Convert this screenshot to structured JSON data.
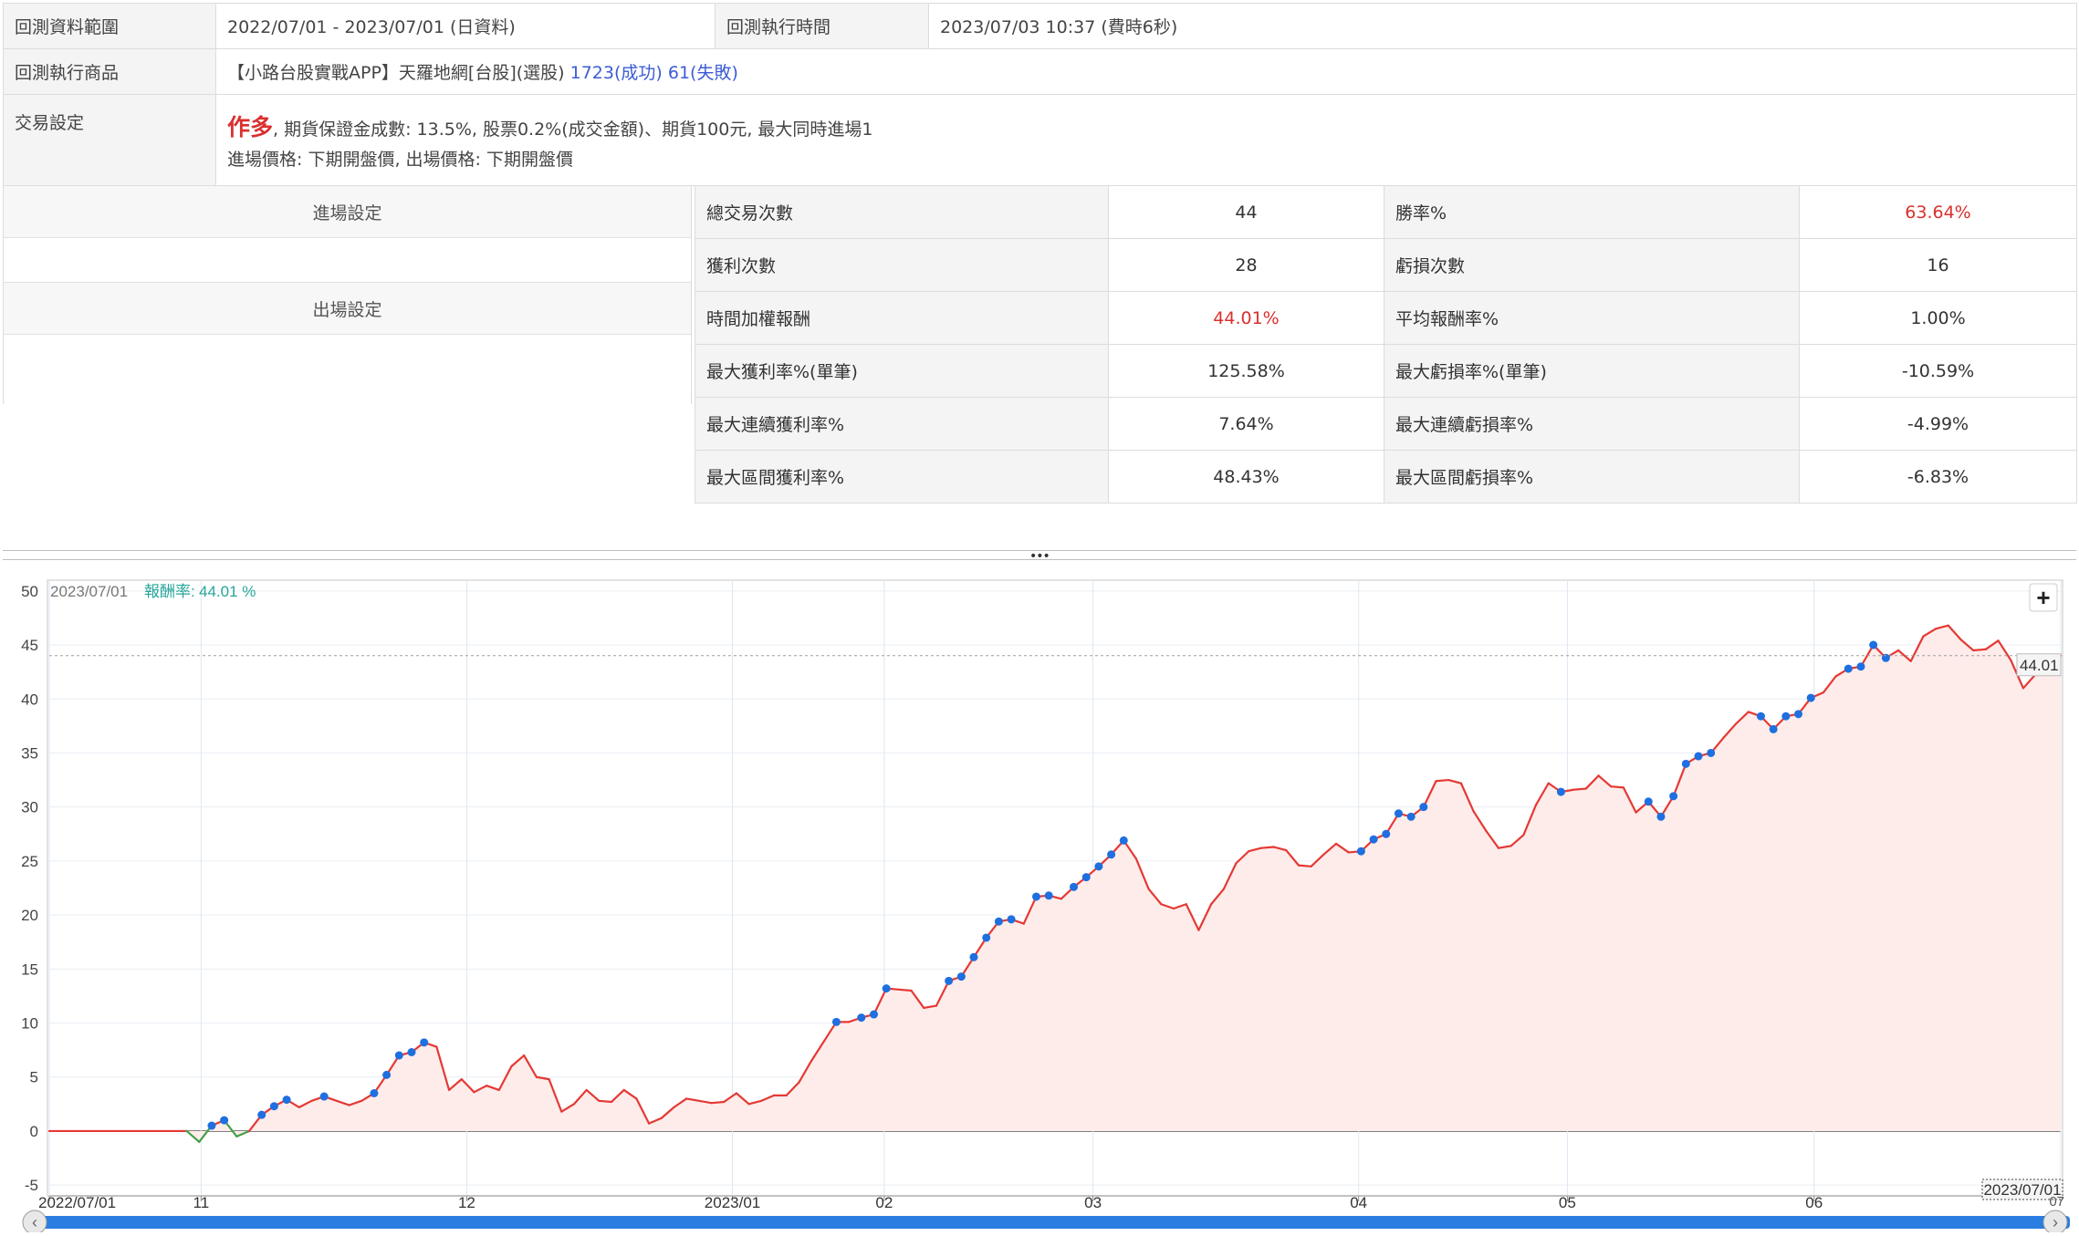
{
  "info": {
    "range_label": "回測資料範圍",
    "range_value": "2022/07/01 - 2023/07/01 (日資料)",
    "exec_time_label": "回測執行時間",
    "exec_time_value": "2023/07/03 10:37 (費時6秒)",
    "product_label": "回測執行商品",
    "product_value": "【小路台股實戰APP】天羅地網[台股](選股)",
    "product_success": "1723(成功)",
    "product_fail": "61(失敗)",
    "trade_label": "交易設定",
    "trade_direction": "作多",
    "trade_detail": ", 期貨保證金成數: 13.5%, 股票0.2%(成交金額)、期貨100元, 最大同時進場1",
    "trade_price": "進場價格: 下期開盤價, 出場價格: 下期開盤價"
  },
  "settings": {
    "entry_label": "進場設定",
    "exit_label": "出場設定"
  },
  "stats": [
    {
      "l1": "總交易次數",
      "v1": "44",
      "l2": "勝率%",
      "v2": "63.64%"
    },
    {
      "l1": "獲利次數",
      "v1": "28",
      "l2": "虧損次數",
      "v2": "16"
    },
    {
      "l1": "時間加權報酬",
      "v1": "44.01%",
      "l2": "平均報酬率%",
      "v2": "1.00%"
    },
    {
      "l1": "最大獲利率%(單筆)",
      "v1": "125.58%",
      "l2": "最大虧損率%(單筆)",
      "v2": "-10.59%"
    },
    {
      "l1": "最大連續獲利率%",
      "v1": "7.64%",
      "l2": "最大連續虧損率%",
      "v2": "-4.99%"
    },
    {
      "l1": "最大區間獲利率%",
      "v1": "48.43%",
      "l2": "最大區間虧損率%",
      "v2": "-6.83%"
    }
  ],
  "colors": {
    "positive_red": "#d9302e",
    "link_blue": "#3b5cd6",
    "line_red": "#e53935",
    "line_green": "#43a047",
    "marker_blue": "#1e6fe0",
    "area_fill": "#fdecea",
    "teal": "#26a69a",
    "scrollbar": "#2a7de1"
  },
  "chart_data": {
    "type": "area",
    "tooltip_date": "2023/07/01",
    "tooltip_label": "報酬率:",
    "tooltip_value": "44.01 %",
    "last_value_label": "44.01",
    "ylim": [
      -6,
      51
    ],
    "yticks": [
      -5,
      0,
      5,
      10,
      15,
      20,
      25,
      30,
      35,
      40,
      45,
      50
    ],
    "xticks": [
      {
        "label": "2022/07/01",
        "idx": 0
      },
      {
        "label": "11",
        "idx": 8
      },
      {
        "label": "12",
        "idx": 22
      },
      {
        "label": "2023/01",
        "idx": 36
      },
      {
        "label": "02",
        "idx": 44
      },
      {
        "label": "03",
        "idx": 55
      },
      {
        "label": "04",
        "idx": 69
      },
      {
        "label": "05",
        "idx": 80
      },
      {
        "label": "06",
        "idx": 93
      },
      {
        "label": "2023/07/01",
        "idx": 106
      }
    ],
    "navigator_end_label": "07",
    "plus_label": "+",
    "x_count": 107,
    "series": [
      {
        "values": [
          0,
          0,
          0,
          0,
          0,
          0,
          0,
          0,
          0,
          0,
          0,
          0,
          -1,
          0.5,
          1,
          -0.5,
          0,
          1.5,
          2.3,
          2.9,
          2.2,
          2.8,
          3.2,
          2.8,
          2.4,
          2.8,
          3.5,
          5.2,
          7,
          7.3,
          8.2,
          7.8,
          3.8,
          4.8,
          3.6,
          4.2,
          3.8,
          6,
          7,
          5,
          4.8,
          1.8,
          2.5,
          3.8,
          2.8,
          2.7,
          3.8,
          3,
          0.7,
          1.2,
          2.2,
          3,
          2.8,
          2.6,
          2.7,
          3.5,
          2.5,
          2.8,
          3.3,
          3.3,
          4.5,
          6.5,
          8.3,
          10.1,
          10.1,
          10.5,
          10.8,
          13.2,
          13.1,
          13,
          11.4,
          11.6,
          13.9,
          14.3,
          16.1,
          17.9,
          19.4,
          19.6,
          19.2,
          21.7,
          21.8,
          21.5,
          22.6,
          23.5,
          24.5,
          25.6,
          26.9,
          25.2,
          22.4,
          21,
          20.6,
          21,
          18.6,
          21,
          22.4,
          24.8,
          25.9,
          26.2,
          26.3,
          26,
          24.6,
          24.5,
          25.6,
          26.6,
          25.8,
          25.9,
          27,
          27.5,
          29.4,
          29.1,
          30,
          32.4,
          32.5,
          32.2,
          29.6,
          27.8,
          26.2,
          26.4,
          27.4,
          30.2,
          32.2,
          31.4,
          31.6,
          31.7,
          32.9,
          31.9,
          31.8,
          29.5,
          30.5,
          29.1,
          31,
          34,
          34.7,
          35,
          36.4,
          37.7,
          38.8,
          38.4,
          37.2,
          38.4,
          38.6,
          40.1,
          40.6,
          42.1,
          42.8,
          43,
          45,
          43.8,
          44.5,
          43.5,
          45.8,
          46.5,
          46.8,
          45.5,
          44.5,
          44.6,
          45.4,
          43.6,
          41,
          42.3,
          44,
          44.01
        ],
        "marker_indices": [
          13,
          14,
          17,
          18,
          19,
          22,
          26,
          27,
          28,
          29,
          30,
          63,
          65,
          66,
          67,
          72,
          73,
          74,
          75,
          76,
          77,
          79,
          80,
          82,
          83,
          84,
          85,
          86,
          105,
          106,
          107,
          108,
          109,
          110,
          121,
          128,
          129,
          130,
          131,
          132,
          133,
          137,
          138,
          139,
          140,
          141,
          144,
          145,
          146,
          147
        ]
      }
    ]
  }
}
